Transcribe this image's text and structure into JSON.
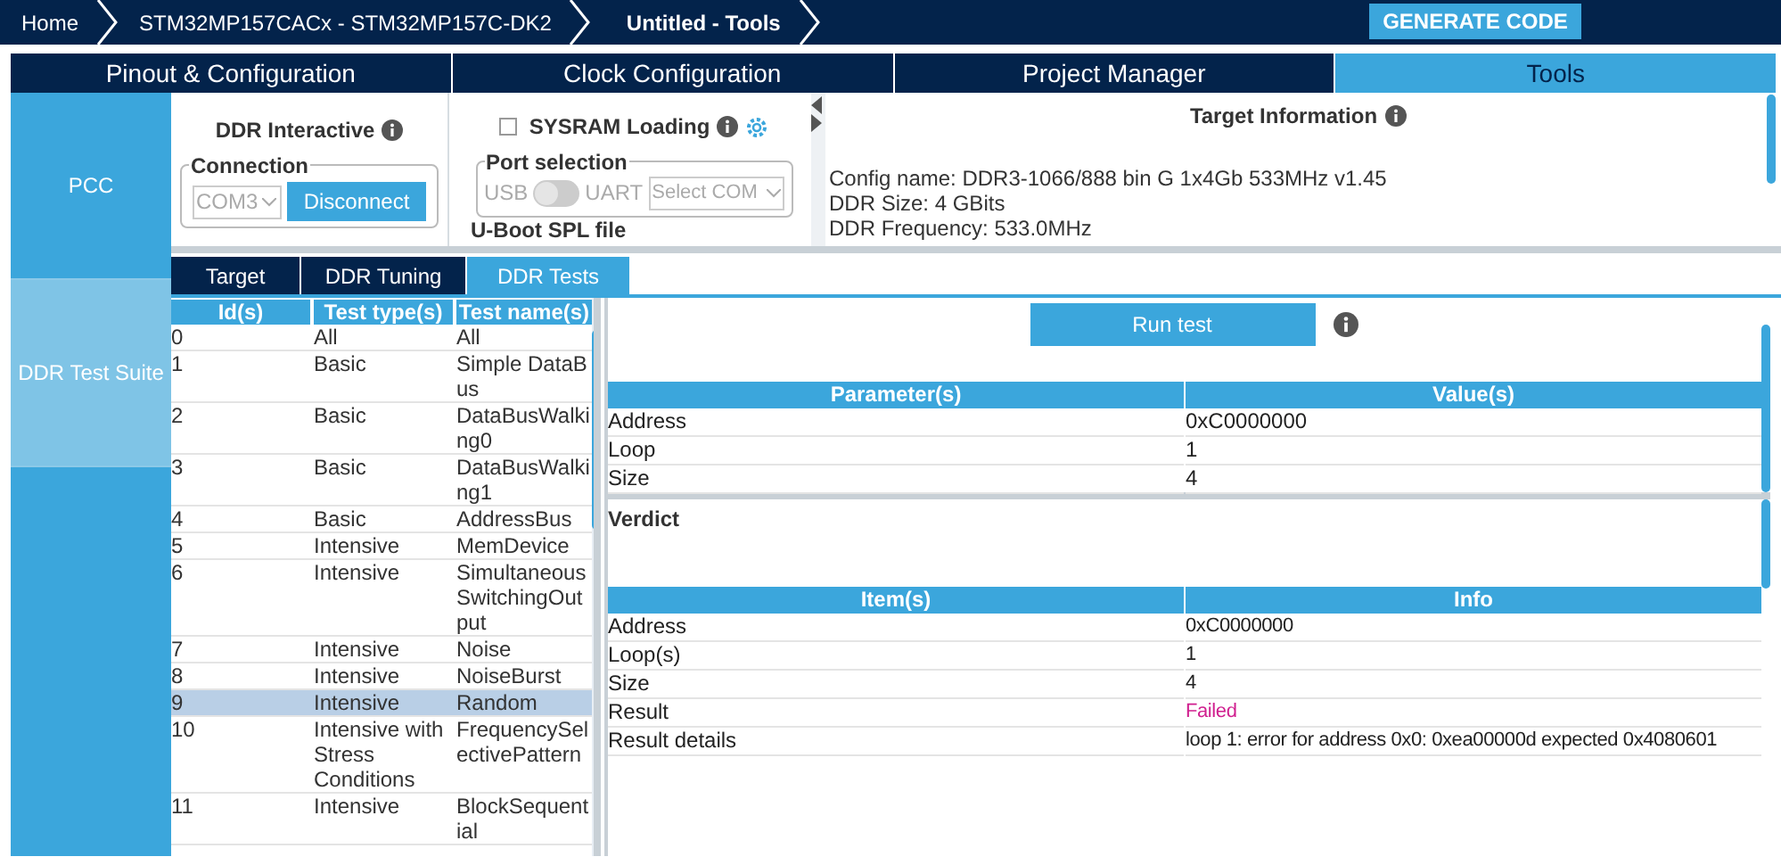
{
  "breadcrumbs": [
    {
      "label": "Home",
      "current": false
    },
    {
      "label": "STM32MP157CACx  -  STM32MP157C-DK2",
      "current": false
    },
    {
      "label": "Untitled - Tools",
      "current": true
    }
  ],
  "generate_button": "GENERATE CODE",
  "main_tabs": [
    {
      "label": "Pinout & Configuration",
      "selected": false
    },
    {
      "label": "Clock Configuration",
      "selected": false
    },
    {
      "label": "Project Manager",
      "selected": false
    },
    {
      "label": "Tools",
      "selected": true
    }
  ],
  "sidebar": [
    {
      "label": "PCC",
      "selected": false
    },
    {
      "label": "DDR Test Suite",
      "selected": true
    }
  ],
  "ddr_interactive": {
    "title": "DDR Interactive",
    "connection_legend": "Connection",
    "port": "COM3",
    "button": "Disconnect"
  },
  "sysram": {
    "label": "SYSRAM Loading",
    "checked": false,
    "port_legend": "Port selection",
    "left_option": "USB",
    "right_option": "UART",
    "toggle_on": false,
    "com_placeholder": "Select COM",
    "file_legend": "U-Boot SPL file"
  },
  "target_info": {
    "title": "Target Information",
    "lines": [
      "Config name: DDR3-1066/888 bin G 1x4Gb 533MHz v1.45",
      "DDR Size: 4 GBits",
      "DDR Frequency: 533.0MHz"
    ]
  },
  "sub_tabs": [
    {
      "label": "Target",
      "selected": false
    },
    {
      "label": "DDR Tuning",
      "selected": false
    },
    {
      "label": "DDR Tests",
      "selected": true
    }
  ],
  "tests": {
    "columns": [
      "Id(s)",
      "Test type(s)",
      "Test name(s)"
    ],
    "rows": [
      {
        "id": "0",
        "type": "All",
        "name": "All",
        "selected": false
      },
      {
        "id": "1",
        "type": "Basic",
        "name": "Simple DataBus",
        "selected": false
      },
      {
        "id": "2",
        "type": "Basic",
        "name": "DataBusWalking0",
        "selected": false
      },
      {
        "id": "3",
        "type": "Basic",
        "name": "DataBusWalking1",
        "selected": false
      },
      {
        "id": "4",
        "type": "Basic",
        "name": "AddressBus",
        "selected": false
      },
      {
        "id": "5",
        "type": "Intensive",
        "name": "MemDevice",
        "selected": false
      },
      {
        "id": "6",
        "type": "Intensive",
        "name": "SimultaneousSwitchingOutput",
        "selected": false
      },
      {
        "id": "7",
        "type": "Intensive",
        "name": "Noise",
        "selected": false
      },
      {
        "id": "8",
        "type": "Intensive",
        "name": "NoiseBurst",
        "selected": false
      },
      {
        "id": "9",
        "type": "Intensive",
        "name": "Random",
        "selected": true
      },
      {
        "id": "10",
        "type": "Intensive with Stress Conditions",
        "name": "FrequencySelectivePattern",
        "selected": false
      },
      {
        "id": "11",
        "type": "Intensive",
        "name": "BlockSequential",
        "selected": false
      }
    ]
  },
  "run_button": "Run test",
  "parameters": {
    "columns": [
      "Parameter(s)",
      "Value(s)"
    ],
    "rows": [
      [
        "Address",
        "0xC0000000"
      ],
      [
        "Loop",
        "1"
      ],
      [
        "Size",
        "4"
      ]
    ]
  },
  "verdict": {
    "title": "Verdict",
    "columns": [
      "Item(s)",
      "Info"
    ],
    "rows": [
      {
        "item": "Address",
        "info": "0xC0000000",
        "kind": "plain"
      },
      {
        "item": "Loop(s)",
        "info": "1",
        "kind": "plain"
      },
      {
        "item": "Size",
        "info": "4",
        "kind": "plain"
      },
      {
        "item": "Result",
        "info": "Failed",
        "kind": "failed"
      },
      {
        "item": "Result details",
        "info": "loop 1: error for address 0x0: 0xea00000d expected 0x4080601",
        "kind": "plain"
      }
    ]
  }
}
